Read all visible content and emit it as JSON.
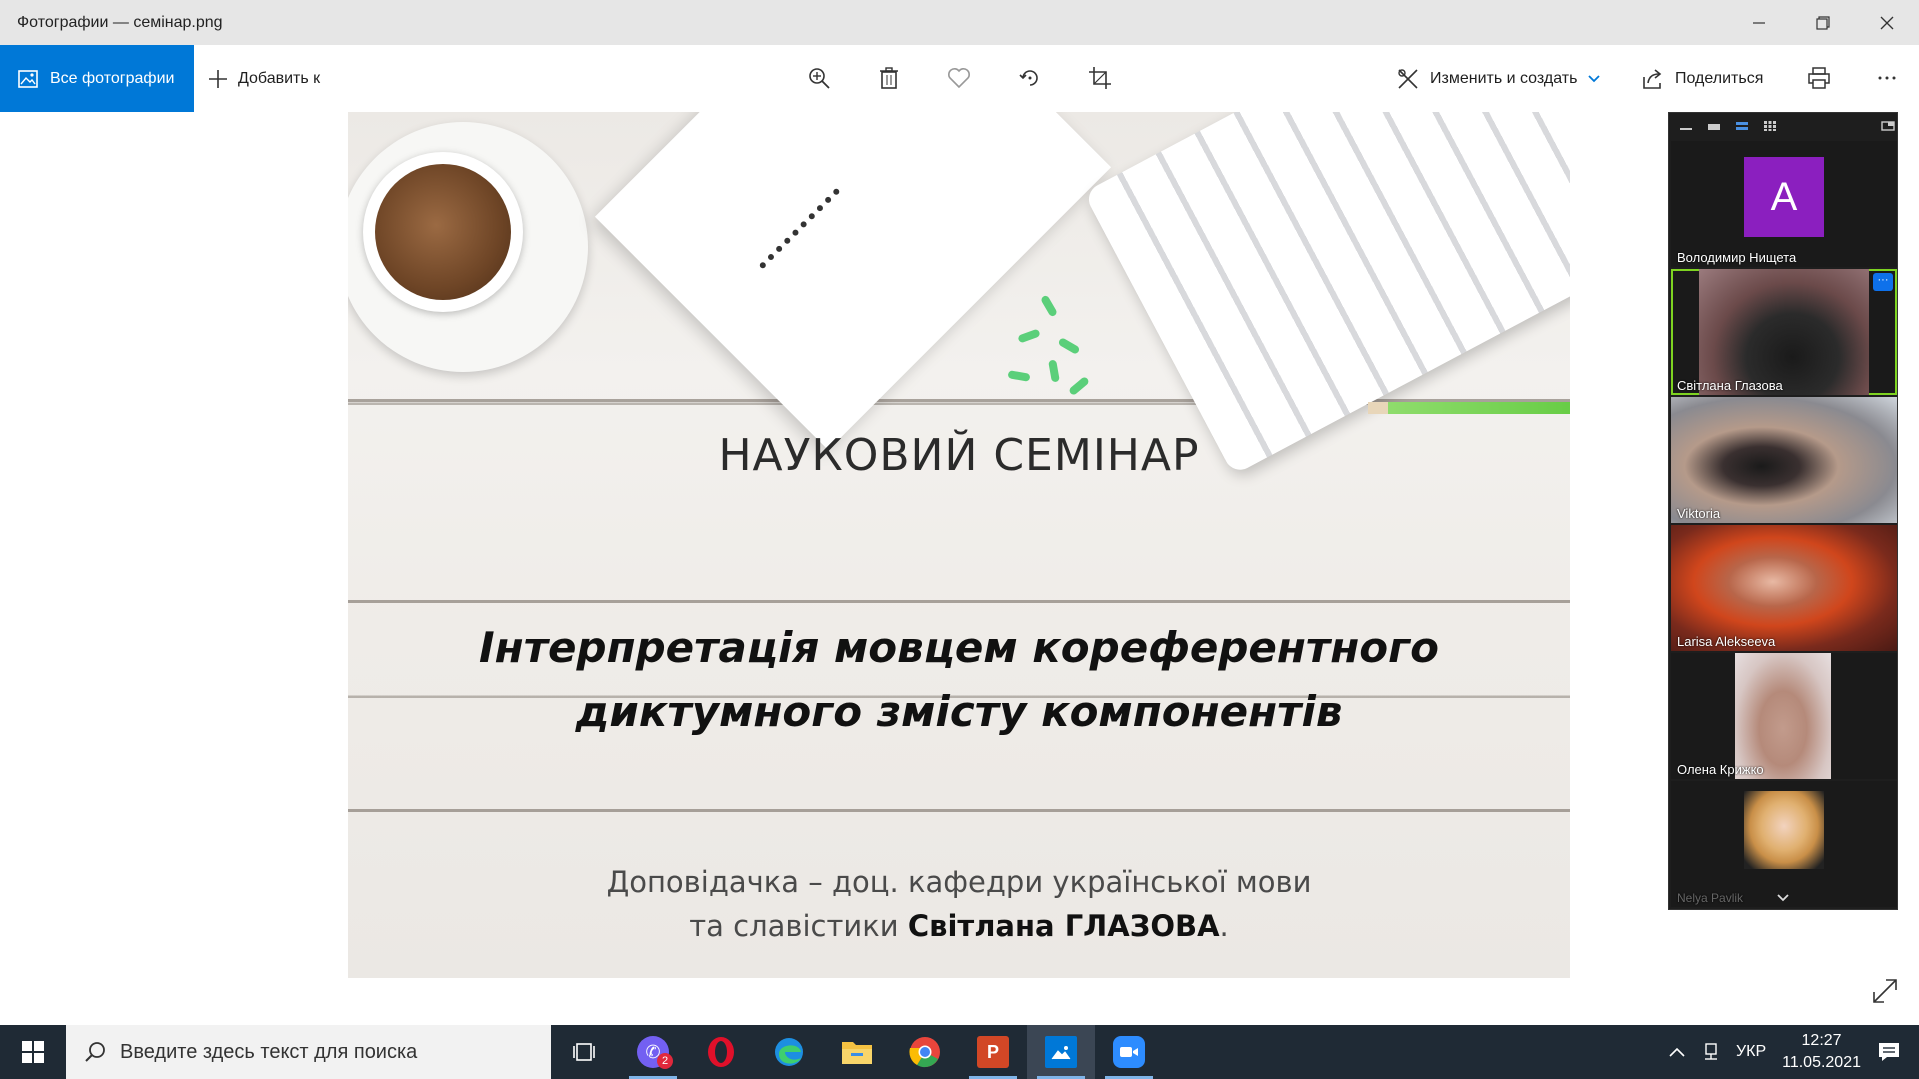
{
  "window": {
    "title": "Фотографии — семінар.png"
  },
  "toolbar": {
    "all_photos_label": "Все фотографии",
    "add_to_label": "Добавить к",
    "edit_create_label": "Изменить и создать",
    "share_label": "Поделиться",
    "icons": [
      "zoom-in-icon",
      "delete-icon",
      "favorite-icon",
      "rotate-icon",
      "crop-icon",
      "print-icon",
      "more-icon"
    ]
  },
  "slide": {
    "heading": "НАУКОВИЙ СЕМІНАР",
    "topic_line1": "Інтерпретація мовцем кореферентного",
    "topic_line2": "диктумного змісту компонентів",
    "speaker_line1": "Доповідачка – доц. кафедри української мови",
    "speaker_line2_prefix": "та славістики ",
    "speaker_name": "Світлана ГЛАЗОВА",
    "speaker_suffix": "."
  },
  "zoom_panel": {
    "participants": [
      {
        "name": "Володимир Нищета",
        "avatar_letter": "A",
        "type": "avatar"
      },
      {
        "name": "Світлана Глазова",
        "type": "video",
        "active_speaker": true
      },
      {
        "name": "Viktoria",
        "type": "video"
      },
      {
        "name": "Larisa Alekseeva",
        "type": "video"
      },
      {
        "name": "Олена Крижко",
        "type": "video"
      },
      {
        "name": "Nelya Pavlik",
        "type": "photo"
      }
    ],
    "more_glyph": "···"
  },
  "taskbar": {
    "search_placeholder": "Введите здесь текст для поиска",
    "viber_badge": "2",
    "language": "УКР",
    "time": "12:27",
    "date": "11.05.2021"
  },
  "colors": {
    "accent": "#0078d7",
    "zoom_avatar": "#8b1fbf",
    "active_speaker_border": "#7ed321",
    "taskbar_bg": "#1f2a35"
  }
}
